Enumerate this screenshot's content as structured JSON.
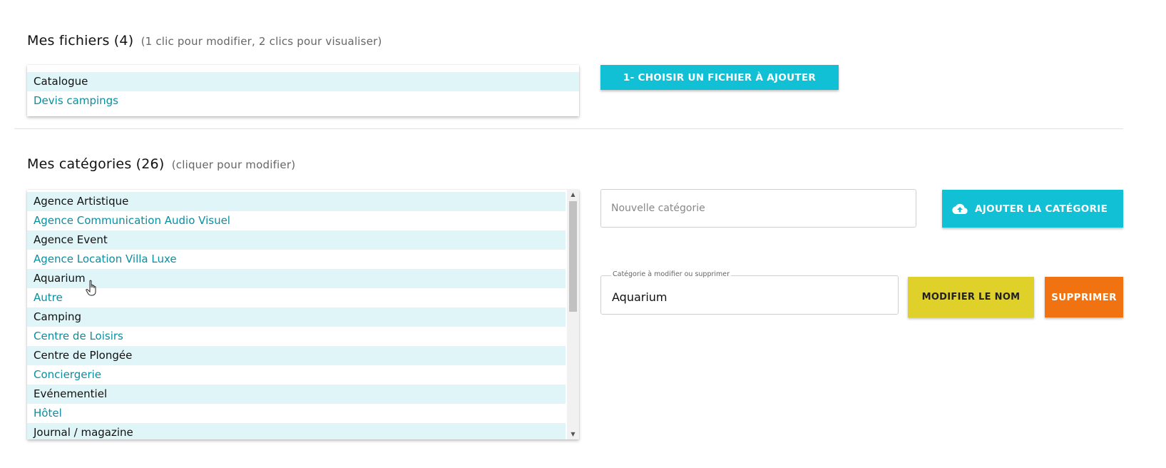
{
  "files": {
    "title": "Mes fichiers (4)",
    "hint": "(1 clic pour modifier, 2 clics pour visualiser)",
    "items": [
      "Catalogue",
      "Devis campings"
    ],
    "choose_button": "1- CHOISIR UN FICHIER À AJOUTER"
  },
  "categories": {
    "title": "Mes catégories (26)",
    "hint": "(cliquer pour modifier)",
    "items": [
      "Agence Artistique",
      "Agence Communication Audio Visuel",
      "Agence Event",
      "Agence Location Villa Luxe",
      "Aquarium",
      "Autre",
      "Camping",
      "Centre de Loisirs",
      "Centre de Plongée",
      "Conciergerie",
      "Evénementiel",
      "Hôtel",
      "Journal / magazine"
    ],
    "new_placeholder": "Nouvelle catégorie",
    "add_button": "AJOUTER LA CATÉGORIE",
    "edit_label": "Catégorie à modifier ou supprimer",
    "edit_value": "Aquarium",
    "rename_button": "MODIFIER LE NOM",
    "delete_button": "SUPPRIMER"
  },
  "icons": {
    "upload": "cloud-upload-icon",
    "cursor": "hand-pointer-icon",
    "scroll_up": "arrow-up-icon",
    "scroll_down": "arrow-down-icon"
  },
  "colors": {
    "accent": "#12c0d6",
    "link": "#0a8fa0",
    "row_alt": "#dff5f8",
    "rename": "#e0d02a",
    "delete": "#f07210"
  }
}
